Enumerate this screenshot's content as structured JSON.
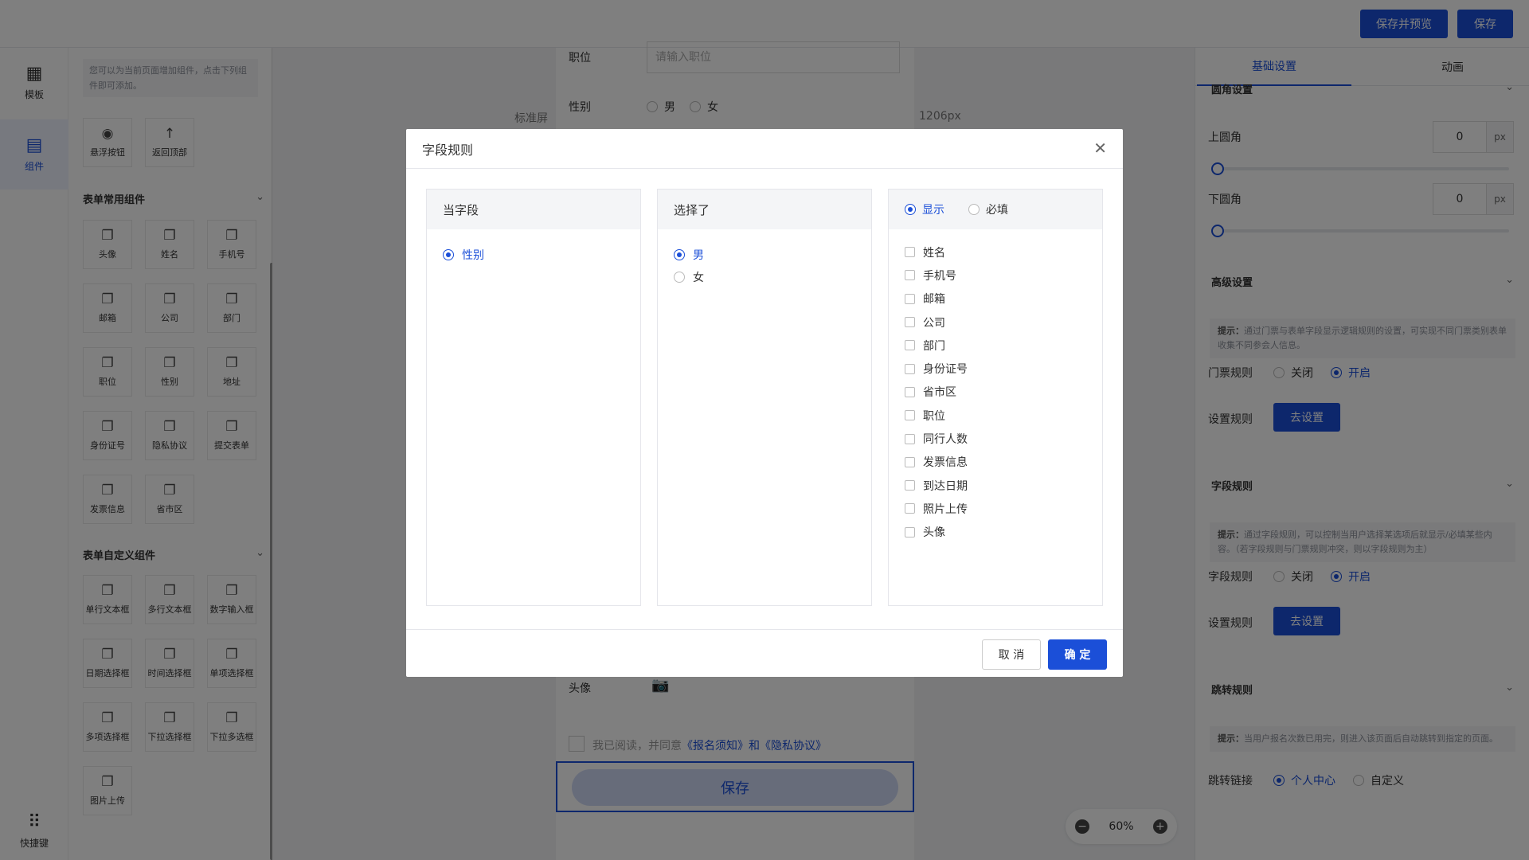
{
  "topbar": {
    "save_preview": "保存并预览",
    "save": "保存"
  },
  "leftnav": {
    "template": "模板",
    "components": "组件",
    "shortcuts": "快捷键"
  },
  "panel": {
    "tip": "您可以为当前页面增加组件，点击下列组件即可添加。",
    "top_items": [
      "悬浮按钮",
      "返回顶部"
    ],
    "form_common_title": "表单常用组件",
    "form_common": [
      "头像",
      "姓名",
      "手机号",
      "邮箱",
      "公司",
      "部门",
      "职位",
      "性别",
      "地址",
      "身份证号",
      "隐私协议",
      "提交表单",
      "发票信息",
      "省市区"
    ],
    "form_custom_title": "表单自定义组件",
    "form_custom": [
      "单行文本框",
      "多行文本框",
      "数字输入框",
      "日期选择框",
      "时间选择框",
      "单项选择框",
      "多项选择框",
      "下拉选择框",
      "下拉多选框",
      "图片上传"
    ]
  },
  "canvas": {
    "screen_label": "标准屏",
    "width_label": "1206px",
    "field_position": "职位",
    "field_position_placeholder": "请输入职位",
    "field_gender": "性别",
    "gender_male": "男",
    "gender_female": "女",
    "field_avatar": "头像",
    "agree_text": "我已阅读，并同意",
    "agree_link": "《报名须知》和《隐私协议》",
    "save_btn": "保存",
    "zoom": "60%"
  },
  "right": {
    "tab_basic": "基础设置",
    "tab_anim": "动画",
    "corner_section": "圆角设置",
    "top_corner": "上圆角",
    "top_corner_value": "0",
    "bottom_corner": "下圆角",
    "bottom_corner_value": "0",
    "unit": "px",
    "advanced": "高级设置",
    "tip_prefix": "提示：",
    "ticket_tip": "通过门票与表单字段显示逻辑规则的设置，可实现不同门票类别表单收集不同参会人信息。",
    "ticket_rule": "门票规则",
    "off": "关闭",
    "on": "开启",
    "set_rule": "设置规则",
    "go_set": "去设置",
    "field_rule_section": "字段规则",
    "field_tip": "通过字段规则，可以控制当用户选择某选项后就显示/必填某些内容。（若字段规则与门票规则冲突，则以字段规则为主）",
    "field_rule": "字段规则",
    "jump_section": "跳转规则",
    "jump_tip": "当用户报名次数已用完，则进入该页面后自动跳转到指定的页面。",
    "jump_link": "跳转链接",
    "personal_center": "个人中心",
    "custom": "自定义"
  },
  "dialog": {
    "title": "字段规则",
    "col1_title": "当字段",
    "col1_items": [
      "性别"
    ],
    "col2_title": "选择了",
    "col2_items": [
      "男",
      "女"
    ],
    "col3_show": "显示",
    "col3_required": "必填",
    "col3_items": [
      "姓名",
      "手机号",
      "邮箱",
      "公司",
      "部门",
      "身份证号",
      "省市区",
      "职位",
      "同行人数",
      "发票信息",
      "到达日期",
      "照片上传",
      "头像"
    ],
    "cancel": "取 消",
    "confirm": "确 定"
  }
}
